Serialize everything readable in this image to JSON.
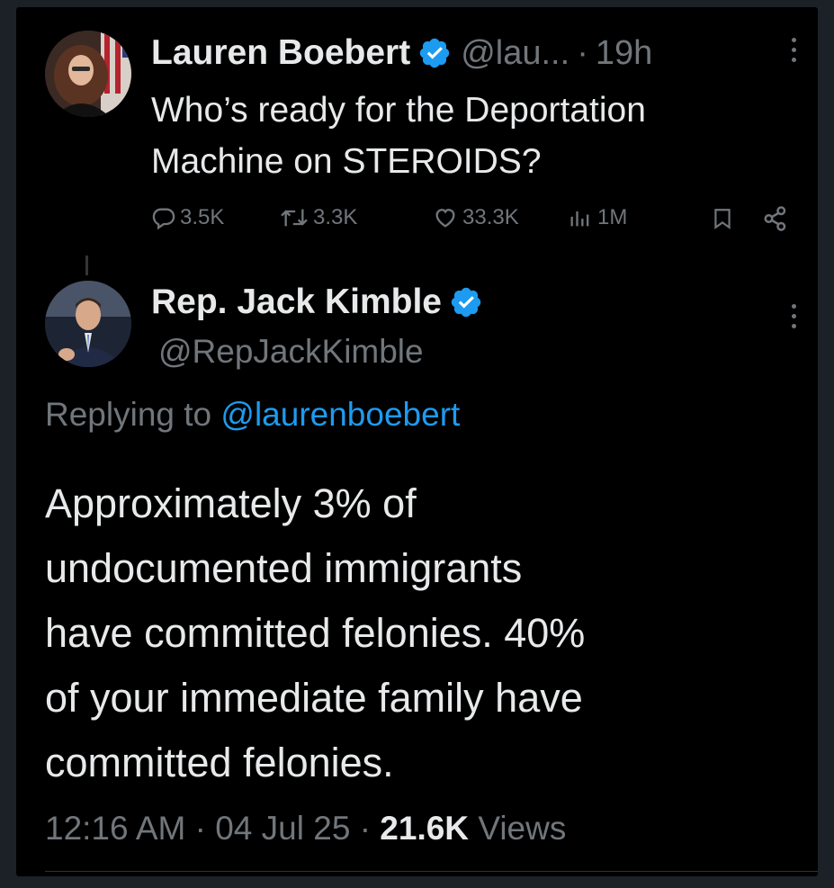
{
  "tweet1": {
    "author_name": "Lauren Boebert",
    "handle": "@lau...",
    "separator": "·",
    "time": "19h",
    "text_line1": "Who’s ready for the Deportation",
    "text_line2": "Machine on STEROIDS?",
    "actions": {
      "replies": "3.5K",
      "reposts": "3.3K",
      "likes": "33.3K",
      "views": "1M"
    }
  },
  "tweet2": {
    "author_name": "Rep. Jack Kimble",
    "handle": "@RepJackKimble",
    "replying_prefix": "Replying to",
    "replying_handle": "@laurenboebert",
    "body_lines": [
      "Approximately 3% of",
      "undocumented immigrants",
      "have committed felonies. 40%",
      "of your immediate family have",
      "committed felonies."
    ],
    "time": "12:16 AM",
    "sep1": "·",
    "date": "04 Jul 25",
    "sep2": "·",
    "views_count": "21.6K",
    "views_label": "Views"
  },
  "colors": {
    "background": "#000000",
    "text": "#e7e9ea",
    "muted": "#71767b",
    "accent": "#1d9bf0"
  },
  "icons": [
    "verified-badge-icon",
    "more-icon",
    "reply-icon",
    "repost-icon",
    "like-icon",
    "views-icon",
    "bookmark-icon",
    "share-icon"
  ]
}
